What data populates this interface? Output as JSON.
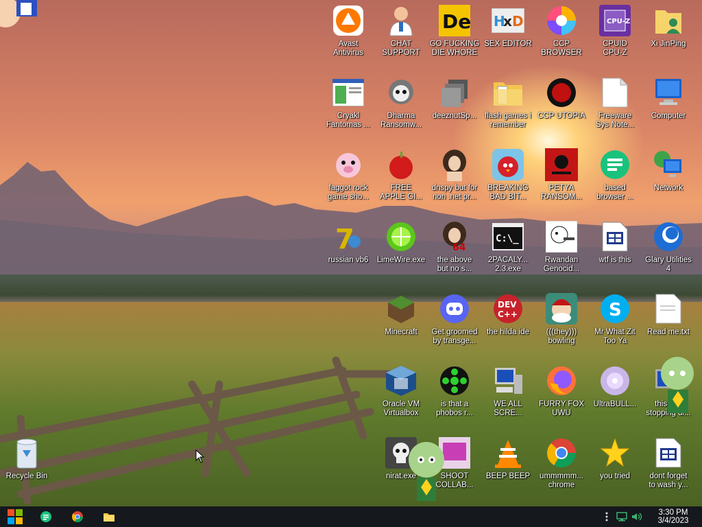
{
  "desktop": {
    "icons": [
      {
        "label": "Avast\nAntivirus",
        "icon": "avast-icon"
      },
      {
        "label": "CHAT\nSUPPORT",
        "icon": "support-person-icon"
      },
      {
        "label": "GO FUCKING\nDIE WHORE",
        "icon": "de-icon"
      },
      {
        "label": "SEX EDITOR",
        "icon": "hxd-icon"
      },
      {
        "label": "CCP\nBROWSER",
        "icon": "ccp-browser-icon"
      },
      {
        "label": "CPUID\nCPU-Z",
        "icon": "cpuz-icon"
      },
      {
        "label": "Xi JinPing",
        "icon": "user-folder-icon"
      },
      {
        "label": "Cryakl\nFantomas ...",
        "icon": "window-app-icon"
      },
      {
        "label": "Dharma\nRansomw...",
        "icon": "skull-helmet-icon"
      },
      {
        "label": "deeznutSp...",
        "icon": "stacked-windows-icon"
      },
      {
        "label": "flash games i\nremember",
        "icon": "folder-icon"
      },
      {
        "label": "CCP UTOPIA",
        "icon": "ccp-utopia-icon"
      },
      {
        "label": "Freeware\nSys Note...",
        "icon": "document-icon"
      },
      {
        "label": "Computer",
        "icon": "computer-icon"
      },
      {
        "label": "faggot rock\ngame sho...",
        "icon": "cartoon-pig-icon"
      },
      {
        "label": "FREE\nAPPLE GI...",
        "icon": "apple-icon"
      },
      {
        "label": "dnspy but for\nnon .net pr...",
        "icon": "portrait-icon"
      },
      {
        "label": "BREAKING\nBAD BIT...",
        "icon": "angry-bird-icon"
      },
      {
        "label": "PETYA\nRANSOM...",
        "icon": "skull-crossbones-icon"
      },
      {
        "label": "based\nbrowser ...",
        "icon": "chat-bubble-icon"
      },
      {
        "label": "Network",
        "icon": "network-icon"
      },
      {
        "label": "russian vb6",
        "icon": "vb6-icon"
      },
      {
        "label": "LimeWire.exe",
        "icon": "limewire-icon"
      },
      {
        "label": "the above\nbut no s...",
        "icon": "portrait-64-icon"
      },
      {
        "label": "2PACALY...\n2.3.exe",
        "icon": "console-icon"
      },
      {
        "label": "Rwandan\nGenocid...",
        "icon": "meme-face-icon"
      },
      {
        "label": "wtf is this",
        "icon": "ini-file-icon"
      },
      {
        "label": "Glary Utilities\n4",
        "icon": "glary-icon"
      },
      {
        "label": "Minecraft",
        "icon": "minecraft-icon"
      },
      {
        "label": "Get groomed\nby transge...",
        "icon": "discord-icon"
      },
      {
        "label": "the hilda ide",
        "icon": "devcpp-icon"
      },
      {
        "label": "(((they)))\nbowling",
        "icon": "santa-icon"
      },
      {
        "label": "Mr What Zit\nToo Ya",
        "icon": "skype-icon"
      },
      {
        "label": "Read me.txt",
        "icon": "text-file-icon"
      },
      {
        "label": "Oracle VM\nVirtualbox",
        "icon": "virtualbox-icon"
      },
      {
        "label": "is that a\nphobos r...",
        "icon": "icq-icon"
      },
      {
        "label": "WE ALL\nSCRE...",
        "icon": "pc-monitor-icon"
      },
      {
        "label": "FURRY FOX\nUWU",
        "icon": "firefox-icon"
      },
      {
        "label": "UltraBULL...",
        "icon": "disc-icon"
      },
      {
        "label": "this aint\nstopping di...",
        "icon": "monitor-sticker-icon"
      },
      {
        "label": "Recycle Bin",
        "icon": "recycle-bin-icon"
      },
      {
        "label": "nirat.exe",
        "icon": "skull-icon"
      },
      {
        "label": "SHOOT\nCOLLAB...",
        "icon": "shoot-icon"
      },
      {
        "label": "BEEP BEEP",
        "icon": "vlc-icon"
      },
      {
        "label": "ummmmm...\nchrome",
        "icon": "chrome-icon"
      },
      {
        "label": "you tried",
        "icon": "star-icon"
      },
      {
        "label": "dont forget\nto wash y...",
        "icon": "ini-file-icon"
      }
    ]
  },
  "taskbar": {
    "start_icon": "windows-logo-icon",
    "pinned": [
      {
        "name": "based-browser",
        "icon": "chat-bubble-icon"
      },
      {
        "name": "chrome",
        "icon": "chrome-icon"
      },
      {
        "name": "file-explorer",
        "icon": "folder-icon"
      }
    ],
    "clock": {
      "time": "3:30 PM",
      "date": "3/4/2023"
    }
  },
  "colors": {
    "taskbar": "#15181c",
    "accent_start": "#1e90ff"
  }
}
